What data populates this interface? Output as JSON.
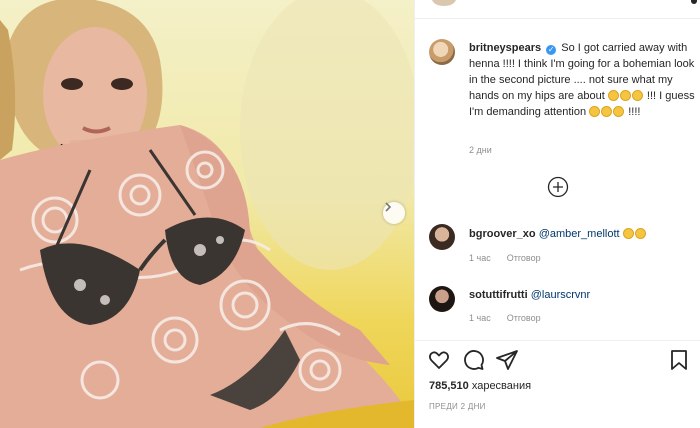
{
  "caption": {
    "username": "britneyspears",
    "verified_glyph": "✓",
    "text": "So I got carried away with henna !!!!  I think I'm going for a bohemian look in the second picture .... not sure what my hands on my hips are about",
    "text_after_emoji1": "!!! I guess I'm demanding attention",
    "text_end": "!!!!",
    "time": "2 дни"
  },
  "comments": [
    {
      "username": "bgroover_xo",
      "mention": "@amber_mellott",
      "time": "1 час",
      "reply_label": "Отговор"
    },
    {
      "username": "sotuttifrutti",
      "mention": "@laurscrvnr",
      "time": "1 час",
      "reply_label": "Отговор"
    }
  ],
  "likes": {
    "count": "785,510",
    "label": "харесвания"
  },
  "posted": "ПРЕДИ 2 ДНИ",
  "icons": {
    "next": "chevron-right-icon",
    "load_more": "plus-circle-icon",
    "like": "heart-icon",
    "comment": "comment-icon",
    "share": "paper-plane-icon",
    "save": "bookmark-icon"
  }
}
